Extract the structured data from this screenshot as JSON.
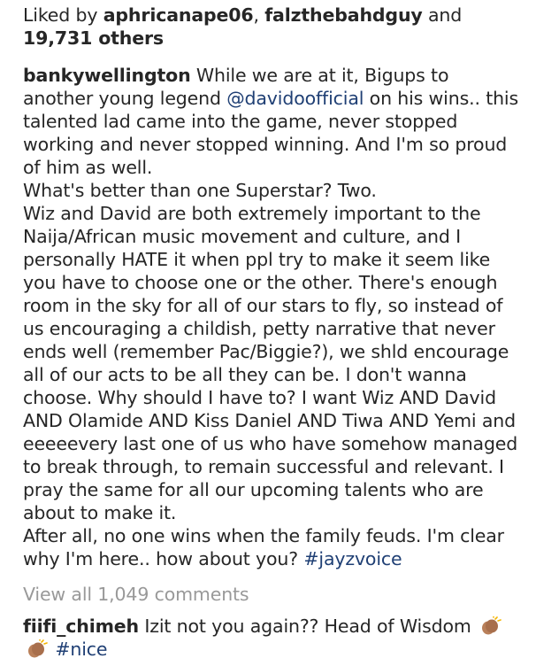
{
  "likes": {
    "prefix": "Liked by",
    "user1": "aphricanape06",
    "separator": ",",
    "user2": "falzthebahdguy",
    "and": "and",
    "others": "19,731 others"
  },
  "caption": {
    "username": "bankywellington",
    "p1_before": "While we are at it, Bigups to another young legend",
    "mention": "@davidoofficial",
    "p1_after": "on his wins.. this talented lad came into the game, never stopped working and never stopped winning. And I'm so proud of him as well.",
    "p2": "What's better than one Superstar? Two.",
    "p3": "Wiz and David are both extremely important to the Naija/African music movement and culture, and I personally HATE it when ppl try to make it seem like you have to choose one or the other. There's enough room in the sky for all of our stars to fly, so instead of us encouraging a childish, petty narrative that never ends well (remember Pac/Biggie?), we shld encourage all of our acts to be all they can be. I don't wanna choose. Why should I have to? I want Wiz AND David AND Olamide AND Kiss Daniel AND Tiwa AND Yemi and eeeeevery last one of us who have somehow managed to break through, to remain successful and relevant. I pray the same for all our upcoming talents who are about to make it.",
    "p4_before": "After all, no one wins when the family feuds. I'm clear why I'm here.. how about you?",
    "hashtag": "#jayzvoice"
  },
  "view_comments": "View all 1,049 comments",
  "comment": {
    "username": "fiifi_chimeh",
    "text": "Izit not you again?? Head of Wisdom",
    "emoji": "clapping-hands-icon",
    "hashtag": "#nice"
  },
  "colors": {
    "text": "#262626",
    "link": "#1f3f74",
    "muted": "#999999",
    "skin": "#b9805a"
  }
}
